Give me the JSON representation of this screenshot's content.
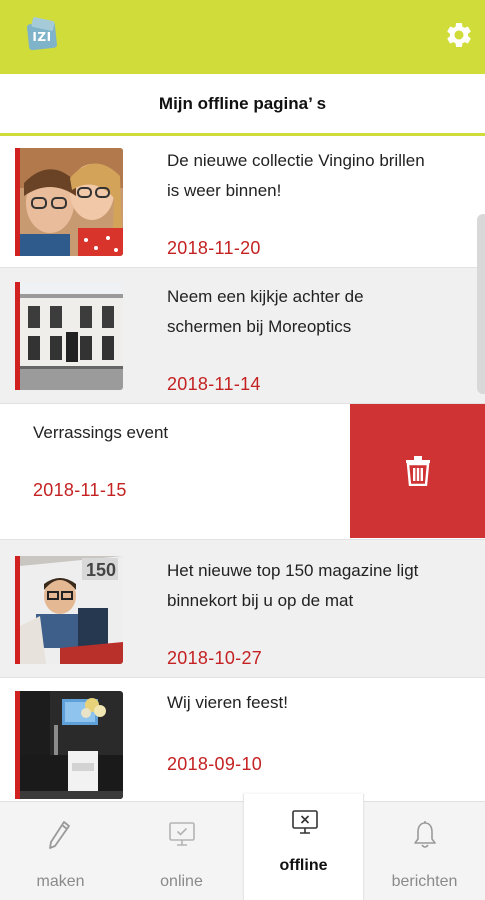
{
  "app": {
    "logo_text": "IZI",
    "settings_icon": "gear-icon",
    "accent_color": "#cfdc3a",
    "danger_color": "#cf3333",
    "date_color": "#c42222"
  },
  "page": {
    "title": "Mijn offline pagina’ s"
  },
  "items": [
    {
      "headline": "De nieuwe collectie Vingino brillen is weer binnen!",
      "date": "2018-11-20"
    },
    {
      "headline": "Neem een kijkje achter de schermen bij Moreoptics",
      "date": "2018-11-14"
    },
    {
      "headline": "Verrassings event",
      "date": "2018-11-15",
      "swipe_action_icon": "trash-icon"
    },
    {
      "headline": "Het nieuwe top 150 magazine ligt binnekort bij u op de mat",
      "date": "2018-10-27"
    },
    {
      "headline": "Wij vieren feest!",
      "date": "2018-09-10"
    }
  ],
  "nav": {
    "tabs": [
      {
        "label": "maken",
        "icon": "pencil-icon"
      },
      {
        "label": "online",
        "icon": "monitor-check-icon"
      },
      {
        "label": "offline",
        "icon": "monitor-x-icon",
        "active": true
      },
      {
        "label": "berichten",
        "icon": "bell-icon"
      }
    ]
  }
}
